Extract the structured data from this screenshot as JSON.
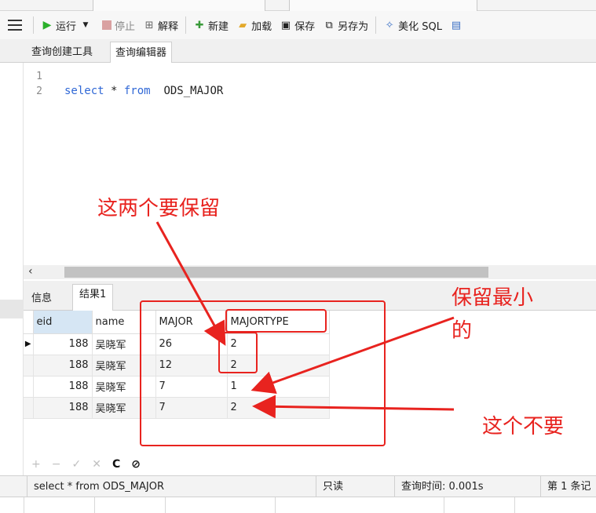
{
  "toolbar": {
    "run_label": "运行",
    "stop_label": "停止",
    "explain_label": "解释",
    "new_label": "新建",
    "load_label": "加载",
    "save_label": "保存",
    "save_as_label": "另存为",
    "beautify_label": "美化 SQL"
  },
  "subtabs": [
    "查询创建工具",
    "查询编辑器"
  ],
  "editor": {
    "line_numbers": [
      "1",
      "2"
    ],
    "keyword_select": "select",
    "star": " * ",
    "keyword_from": "from",
    "table_name": "  ODS_MAJOR"
  },
  "result_tabs": [
    "信息",
    "结果1"
  ],
  "grid": {
    "columns": [
      "eid",
      "name",
      "MAJOR",
      "MAJORTYPE"
    ],
    "rows": [
      {
        "eid": "188",
        "name": "吴晓军",
        "major": "26",
        "majortype": "2"
      },
      {
        "eid": "188",
        "name": "吴晓军",
        "major": "12",
        "majortype": "2"
      },
      {
        "eid": "188",
        "name": "吴晓军",
        "major": "7",
        "majortype": "1"
      },
      {
        "eid": "188",
        "name": "吴晓军",
        "major": "7",
        "majortype": "2"
      }
    ]
  },
  "gridbar_icons": [
    "+",
    "−",
    "✓",
    "✕",
    "C",
    "⊘"
  ],
  "status": {
    "sql": "select * from  ODS_MAJOR",
    "mode": "只读",
    "query_time": "查询时间: 0.001s",
    "record": "第 1 条记"
  },
  "annotations": {
    "keep_both": "这两个要保留",
    "keep_min_line1": "保留最小",
    "keep_min_line2": "的",
    "not_wanted": "这个不要"
  },
  "colors": {
    "annotation_red": "#e8231f",
    "keyword_blue": "#3068d6",
    "header_highlight": "#d6e6f4"
  }
}
